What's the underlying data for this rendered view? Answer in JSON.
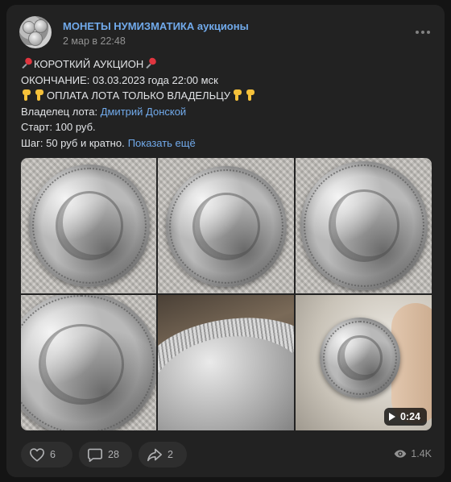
{
  "post": {
    "group_name": "МОНЕТЫ НУМИЗМАТИКА аукционы",
    "date": "2 мар в 22:48",
    "lines": {
      "l1": "КОРОТКИЙ АУКЦИОН",
      "l2": "ОКОНЧАНИЕ: 03.03.2023 года 22:00 мск",
      "l3": "ОПЛАТА ЛОТА ТОЛЬКО ВЛАДЕЛЬЦУ",
      "l4_prefix": "Владелец лота: ",
      "l4_link": "Дмитрий Донской",
      "l5": "Старт: 100 руб.",
      "l6": "Шаг: 50 руб и кратно.",
      "show_more": "Показать ещё"
    },
    "emojis": {
      "pushpin": "pushpin-icon",
      "thumbs_down": "thumbs-down-icon"
    },
    "media": {
      "photos": [
        "coin-photo",
        "coin-photo",
        "coin-photo",
        "coin-photo",
        "coin-photo"
      ],
      "video_duration": "0:24"
    }
  },
  "footer": {
    "likes": "6",
    "comments": "28",
    "shares": "2",
    "views": "1.4K"
  },
  "colors": {
    "link": "#71aaeb",
    "card_bg": "#222222",
    "page_bg": "#141414",
    "text": "#e1e3e6",
    "muted": "#939393"
  }
}
